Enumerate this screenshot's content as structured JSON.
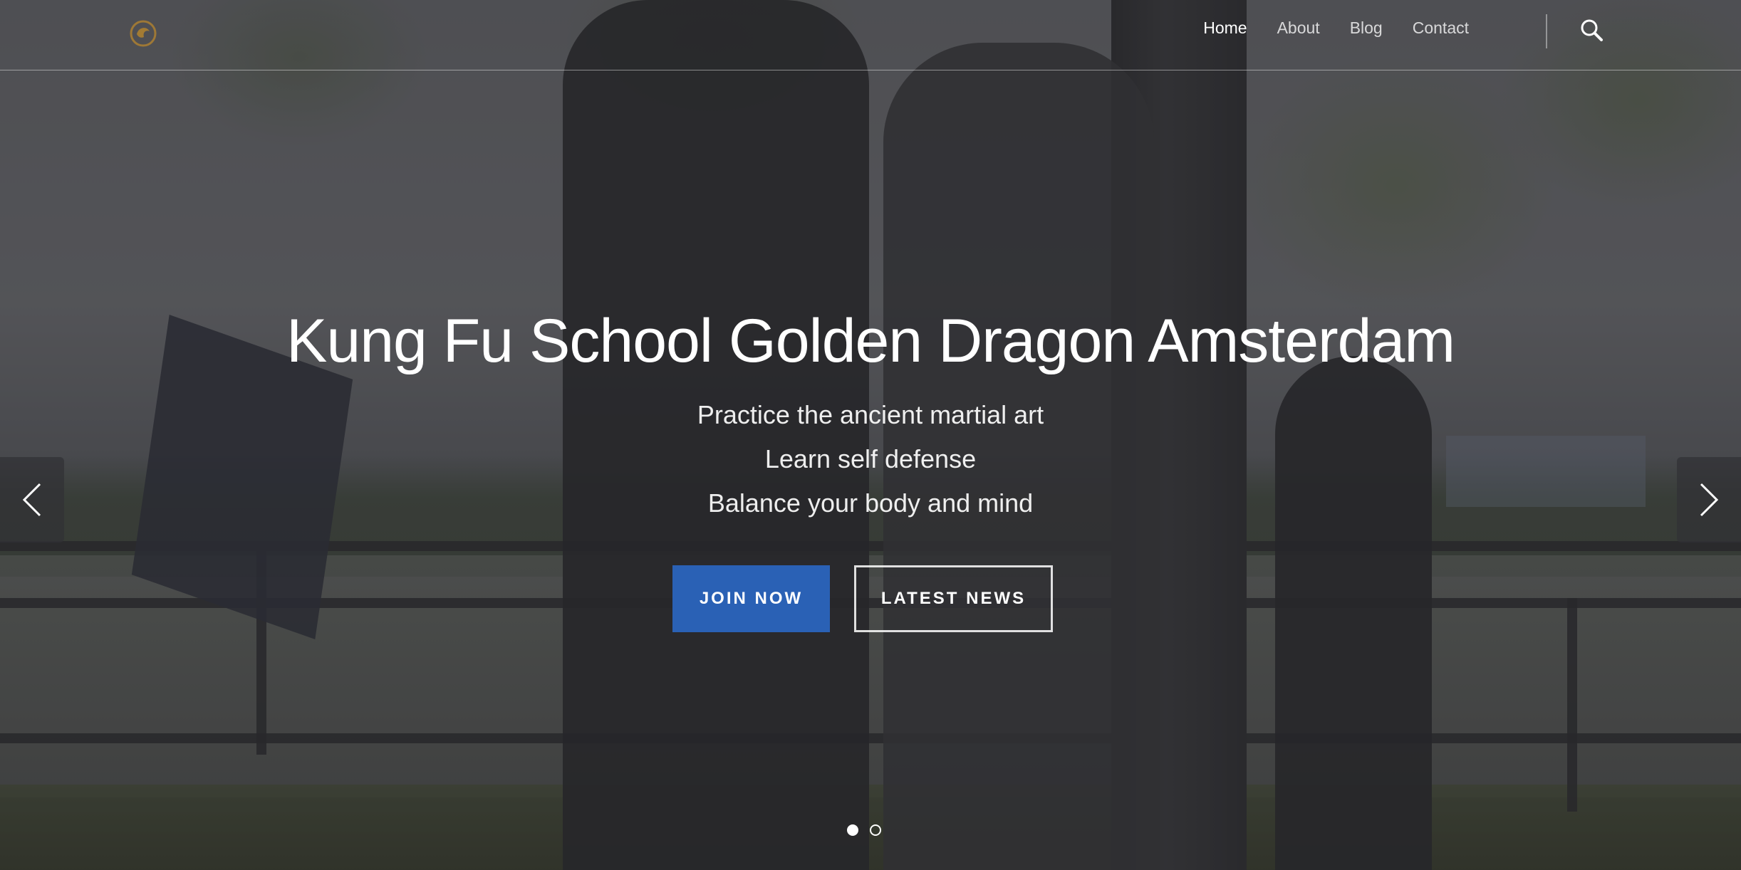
{
  "nav": {
    "items": [
      {
        "label": "Home",
        "active": true
      },
      {
        "label": "About",
        "active": false
      },
      {
        "label": "Blog",
        "active": false
      },
      {
        "label": "Contact",
        "active": false
      }
    ],
    "search_icon": "search-icon"
  },
  "logo": {
    "icon": "dragon-logo-icon",
    "color": "#b8862c"
  },
  "hero": {
    "title": "Kung Fu School Golden Dragon Amsterdam",
    "lines": [
      "Practice the ancient martial art",
      "Learn self defense",
      "Balance your body and mind"
    ],
    "join_label": "JOIN NOW",
    "news_label": "LATEST NEWS"
  },
  "slider": {
    "prev_icon": "chevron-left-icon",
    "next_icon": "chevron-right-icon",
    "slides": 2,
    "active_slide": 1
  },
  "colors": {
    "accent": "#2a61b5",
    "text": "#ffffff"
  }
}
